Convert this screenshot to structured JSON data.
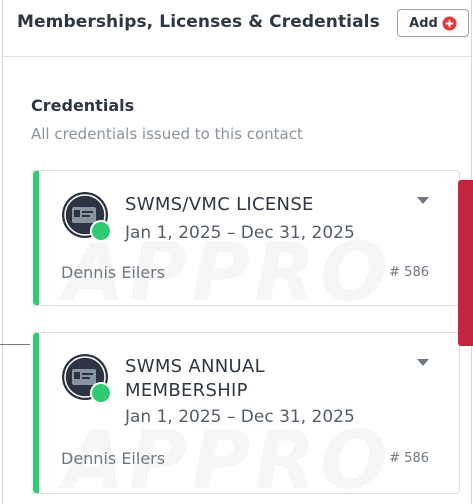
{
  "header": {
    "title": "Memberships, Licenses & Credentials",
    "add_label": "Add"
  },
  "section": {
    "title": "Credentials",
    "subtitle": "All credentials issued to this contact"
  },
  "cards": [
    {
      "name_line1": "SWMS/VMC LICENSE",
      "name_line2": "",
      "dates": "Jan 1, 2025 – Dec 31, 2025",
      "person": "Dennis Eilers",
      "number": "# 586",
      "watermark": "APPRO",
      "status_color": "#2ecc71"
    },
    {
      "name_line1": "SWMS ANNUAL",
      "name_line2": "MEMBERSHIP",
      "dates": "Jan 1, 2025 – Dec 31, 2025",
      "person": "Dennis Eilers",
      "number": "# 586",
      "watermark": "APPRO",
      "status_color": "#2ecc71"
    }
  ],
  "colors": {
    "accent_green": "#2ecc71",
    "add_icon_red": "#e03a3e",
    "side_strip_red": "#c2273f"
  },
  "icons": {
    "add": "plus-circle-icon",
    "credential": "id-card-icon",
    "menu": "caret-down-icon"
  }
}
